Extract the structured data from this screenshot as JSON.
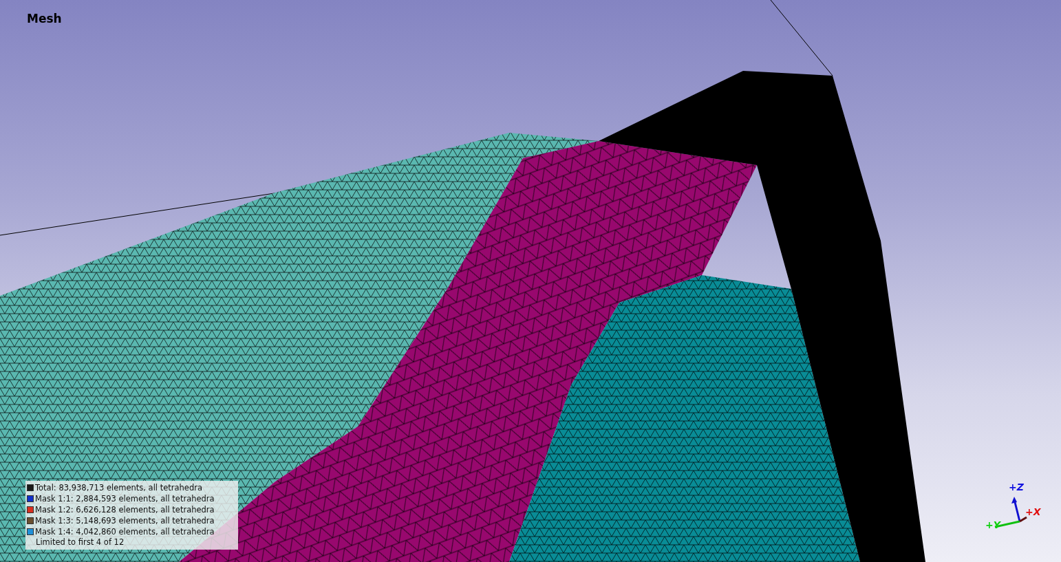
{
  "viewport": {
    "title": "Mesh"
  },
  "legend": {
    "items": [
      {
        "label": "Total: 83,938,713 elements, all tetrahedra",
        "color": "#1a1a1a"
      },
      {
        "label": "Mask 1:1: 2,884,593 elements, all tetrahedra",
        "color": "#1030c8"
      },
      {
        "label": "Mask 1:2: 6,626,128 elements, all tetrahedra",
        "color": "#d83020"
      },
      {
        "label": "Mask 1:3: 5,148,693 elements, all tetrahedra",
        "color": "#6a5030"
      },
      {
        "label": "Mask 1:4: 4,042,860 elements, all tetrahedra",
        "color": "#2090d8"
      }
    ],
    "note": "Limited to first 4 of 12"
  },
  "triad": {
    "z": "+Z",
    "x": "+X",
    "y": "+Y"
  }
}
